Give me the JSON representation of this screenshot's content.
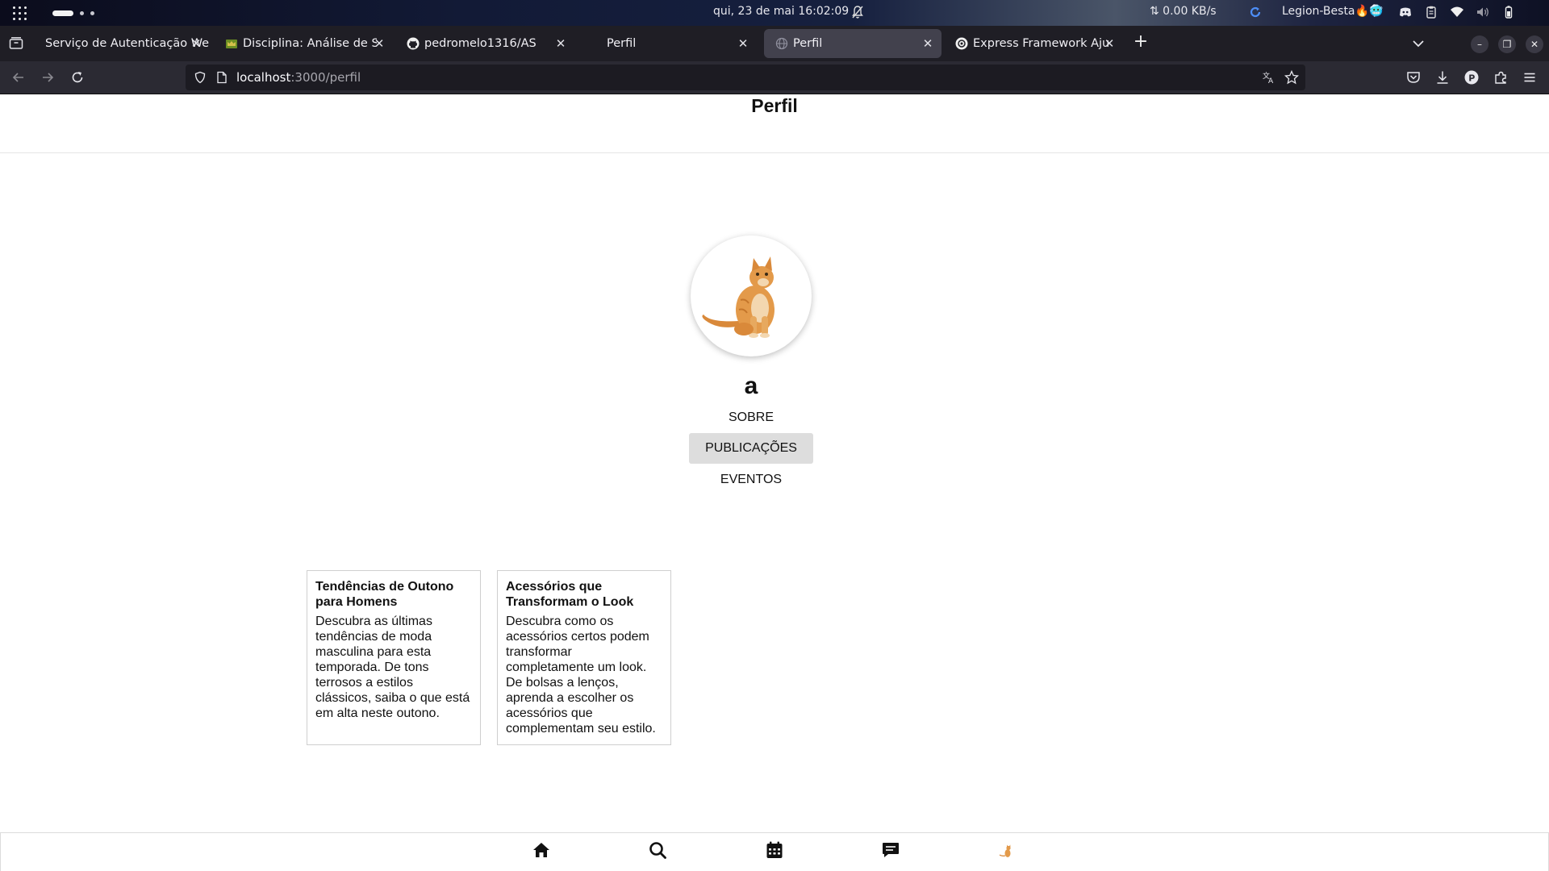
{
  "system_bar": {
    "clock": "qui, 23 de mai  16:02:09",
    "network_speed": "⇅ 0.00 KB/s",
    "username": "Legion-Besta🔥🥶"
  },
  "browser": {
    "tabs": [
      {
        "label": "Serviço de Autenticação Web",
        "icon": "page-icon",
        "active": false
      },
      {
        "label": "Disciplina: Análise de Sist",
        "icon": "crown-icon",
        "active": false
      },
      {
        "label": "pedromelo1316/AS",
        "icon": "github-icon",
        "active": false
      },
      {
        "label": "Perfil",
        "icon": "none",
        "active": false
      },
      {
        "label": "Perfil",
        "icon": "globe-icon",
        "active": true
      },
      {
        "label": "Express Framework Ajuda",
        "icon": "openai-icon",
        "active": false
      }
    ],
    "url_host": "localhost",
    "url_path": ":3000/perfil"
  },
  "page": {
    "title": "Perfil",
    "username": "a",
    "menu": [
      {
        "label": "SOBRE",
        "active": false
      },
      {
        "label": "PUBLICAÇÕES",
        "active": true
      },
      {
        "label": "EVENTOS",
        "active": false
      }
    ],
    "posts": [
      {
        "title": "Tendências de Outono para Homens",
        "body": "Descubra as últimas tendências de moda masculina para esta temporada. De tons terrosos a estilos clássicos, saiba o que está em alta neste outono."
      },
      {
        "title": "Acessórios que Transformam o Look",
        "body": "Descubra como os acessórios certos podem transformar completamente um look. De bolsas a lenços, aprenda a escolher os acessórios que complementam seu estilo."
      }
    ],
    "bottom_nav": [
      "home-icon",
      "search-icon",
      "calendar-icon",
      "chat-icon",
      "profile-avatar-icon"
    ]
  },
  "colors": {
    "tab_strip": "#1f1e25",
    "active_tab": "#42414d",
    "toolbar": "#2b2a33",
    "menu_active_bg": "#dddddd"
  }
}
